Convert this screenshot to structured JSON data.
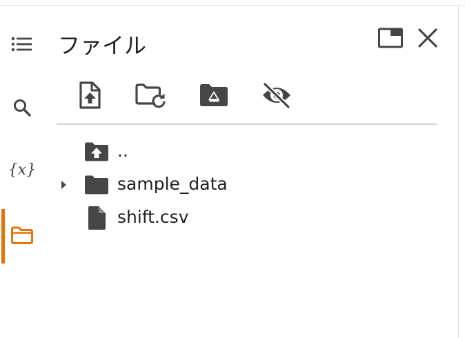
{
  "panel": {
    "title": "ファイル"
  },
  "rail": {
    "items": [
      {
        "icon": "table-of-contents-icon",
        "active": false
      },
      {
        "icon": "search-icon",
        "active": false
      },
      {
        "icon": "variables-icon",
        "label": "{x}",
        "active": false
      },
      {
        "icon": "folder-icon",
        "active": true
      }
    ],
    "active_color": "#e8710a"
  },
  "header_actions": [
    {
      "icon": "open-in-tab-icon"
    },
    {
      "icon": "close-icon"
    }
  ],
  "toolbar": [
    {
      "icon": "upload-file-icon"
    },
    {
      "icon": "refresh-folder-icon"
    },
    {
      "icon": "mount-drive-icon"
    },
    {
      "icon": "hide-files-icon"
    }
  ],
  "file_tree": [
    {
      "name": "..",
      "type": "parent",
      "icon": "folder-up-icon",
      "expandable": false
    },
    {
      "name": "sample_data",
      "type": "folder",
      "icon": "folder-icon",
      "expandable": true
    },
    {
      "name": "shift.csv",
      "type": "file",
      "icon": "file-icon",
      "expandable": false
    }
  ],
  "colors": {
    "icon": "#444746",
    "text": "#202124",
    "divider": "#d3d5d8"
  }
}
